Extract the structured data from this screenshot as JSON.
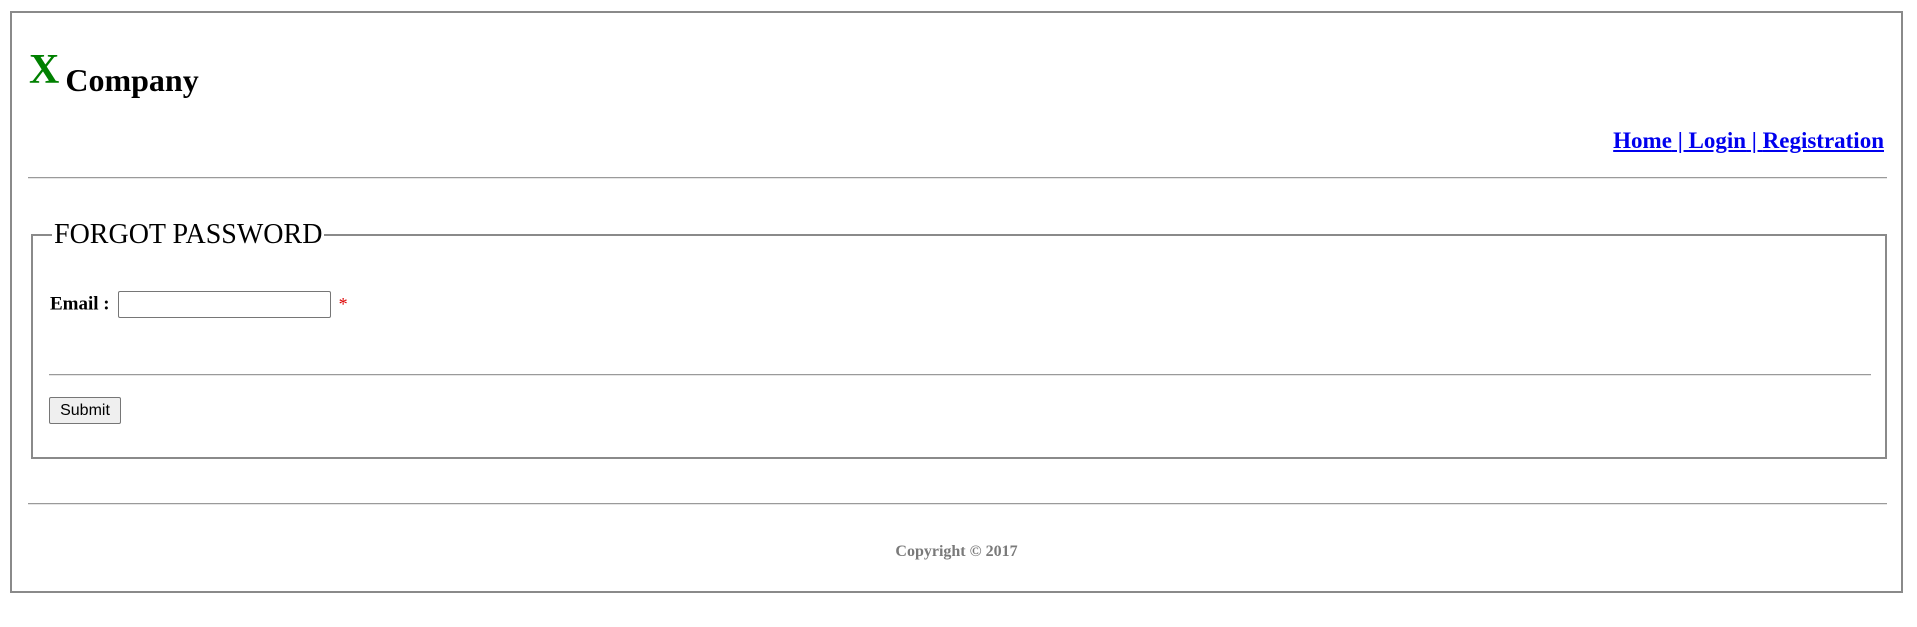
{
  "header": {
    "logo_mark": "X",
    "company_name": "Company"
  },
  "nav": {
    "home": "Home",
    "separator": " | ",
    "login": "Login",
    "registration": "Registration"
  },
  "form": {
    "legend": "FORGOT PASSWORD",
    "email_label": "Email :",
    "email_value": "",
    "required_mark": "*",
    "submit_label": "Submit"
  },
  "footer": {
    "copyright": "Copyright © 2017"
  },
  "colors": {
    "logo_mark": "#008000",
    "link": "#0000ee",
    "required": "#dd0000",
    "footer_text": "#7a7a7a",
    "border": "#8a8a8a"
  }
}
